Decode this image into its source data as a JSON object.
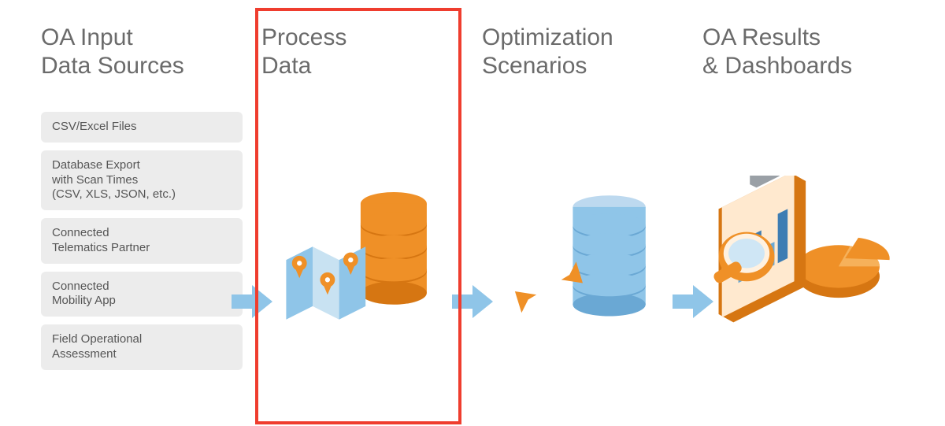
{
  "columns": {
    "sources": {
      "title": "OA Input\nData Sources"
    },
    "process": {
      "title": "Process\nData"
    },
    "optimize": {
      "title": "Optimization\nScenarios"
    },
    "results": {
      "title": "OA Results\n& Dashboards"
    }
  },
  "source_items": [
    "CSV/Excel Files",
    "Database Export\nwith Scan Times\n(CSV, XLS, JSON, etc.)",
    "Connected\nTelematics Partner",
    "Connected\nMobility App",
    "Field Operational\nAssessment"
  ],
  "colors": {
    "arrow": "#8fc5e8",
    "orange": "#ef9027",
    "orange_dark": "#d67612",
    "blue": "#8fc5e8",
    "blue_dark": "#6aa8d4",
    "highlight": "#ef3d2e",
    "text": "#6b6b6b"
  }
}
